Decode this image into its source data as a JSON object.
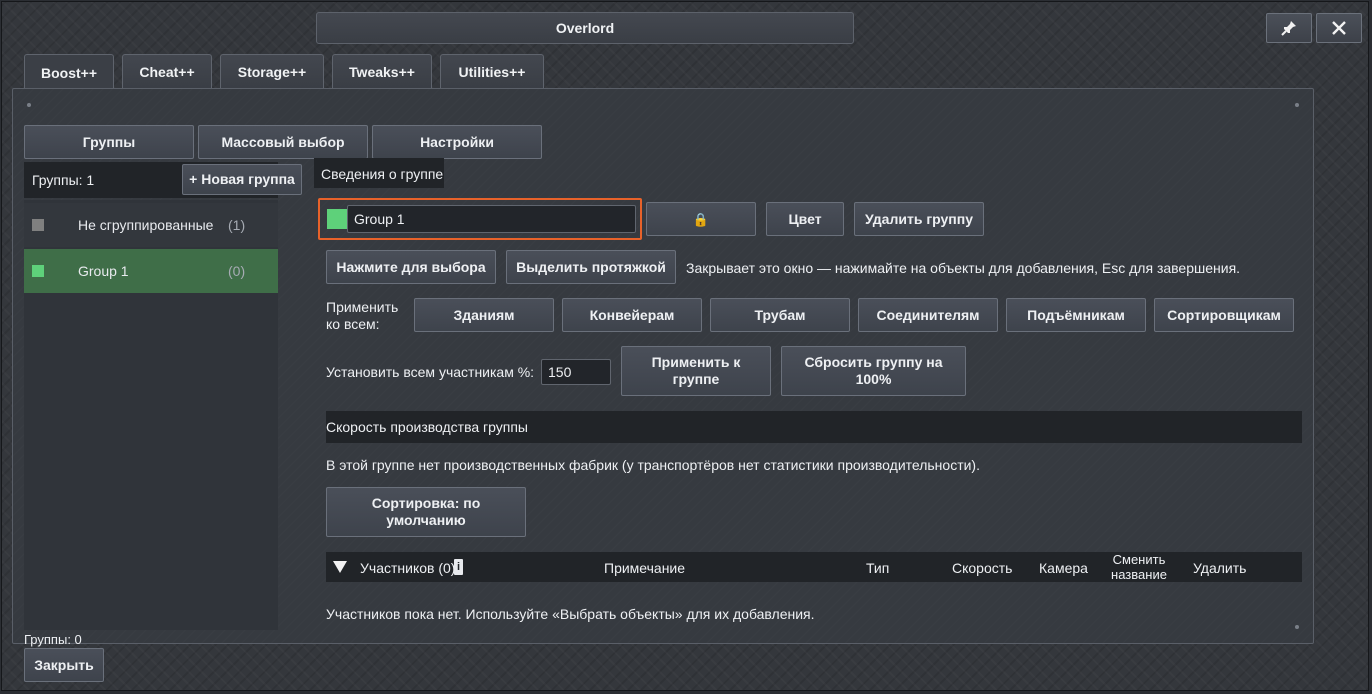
{
  "window": {
    "title": "Overlord"
  },
  "tabs": [
    {
      "label": "Boost++"
    },
    {
      "label": "Cheat++"
    },
    {
      "label": "Storage++"
    },
    {
      "label": "Tweaks++"
    },
    {
      "label": "Utilities++"
    }
  ],
  "subtabs": {
    "groups": "Группы",
    "mass_select": "Массовый выбор",
    "settings": "Настройки"
  },
  "sidebar": {
    "count_label": "Группы: 1",
    "new_group": "+ Новая группа",
    "items": [
      {
        "name": "Не сгруппированные",
        "count": "(1)",
        "color": "#808080"
      },
      {
        "name": "Group 1",
        "count": "(0)",
        "color": "#5ed17a"
      }
    ],
    "footer_count": "Группы: 0"
  },
  "details": {
    "header": "Сведения о группе",
    "group_name_value": "Group 1",
    "group_color": "#5ed17a",
    "lock_icon": "🔒",
    "color_button": "Цвет",
    "delete_button": "Удалить группу",
    "click_select_button": "Нажмите для выбора",
    "drag_select_button": "Выделить протяжкой",
    "hint": "Закрывает это окно — нажимайте на объекты для добавления, Esc для завершения.",
    "apply_all_label_line1": "Применить",
    "apply_all_label_line2": "ко всем:",
    "apply_targets": [
      "Зданиям",
      "Конвейерам",
      "Трубам",
      "Соединителям",
      "Подъёмникам",
      "Сортировщикам"
    ],
    "set_percent_label": "Установить всем участникам %:",
    "percent_value": "150",
    "apply_to_group_line1": "Применить к",
    "apply_to_group_line2": "группе",
    "reset_group_line1": "Сбросить группу на",
    "reset_group_line2": "100%",
    "speed_header": "Скорость производства группы",
    "no_factories_note": "В этой группе нет производственных фабрик (у транспортёров нет статистики производительности).",
    "sort_line1": "Сортировка: по",
    "sort_line2": "умолчанию"
  },
  "members_table": {
    "members_header": "Участников (0)",
    "info_badge": "i",
    "columns": {
      "note": "Примечание",
      "type": "Тип",
      "speed": "Скорость",
      "camera": "Камера",
      "rename_line1": "Сменить",
      "rename_line2": "название",
      "delete": "Удалить"
    },
    "empty_note": "Участников пока нет. Используйте «Выбрать объекты» для их добавления."
  },
  "footer": {
    "close_button": "Закрыть"
  },
  "colors": {
    "accent_highlight": "#e8622a",
    "selected_row": "#3f6e48"
  }
}
